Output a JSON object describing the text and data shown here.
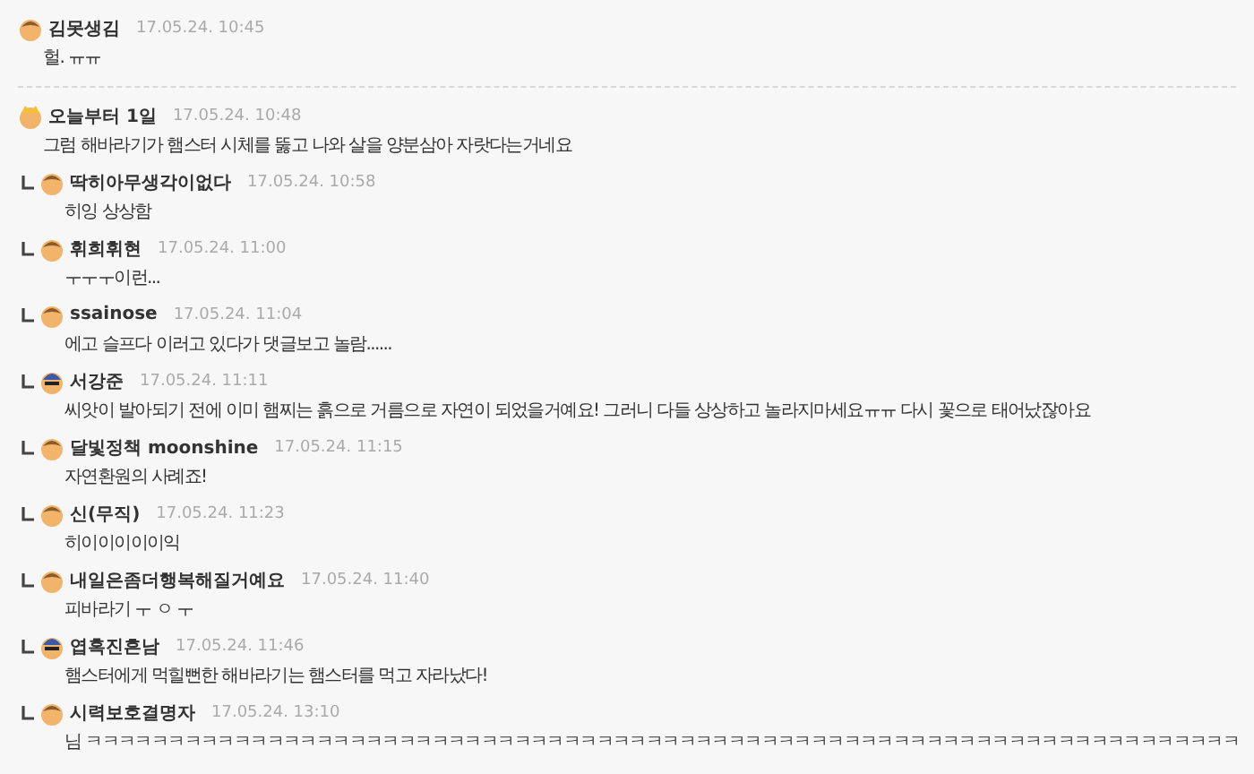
{
  "comments": [
    {
      "author": "김못생김",
      "time": "17.05.24. 10:45",
      "kind": "plain",
      "text": "헐. ㅠㅠ"
    },
    {
      "author": "오늘부터 1일",
      "time": "17.05.24. 10:48",
      "kind": "crown",
      "text": "그럼 해바라기가 햄스터 시체를 뚫고 나와 살을 양분삼아 자랏다는거네요",
      "children": [
        {
          "author": "딱히아무생각이없다",
          "time": "17.05.24. 10:58",
          "kind": "plain",
          "text": "히잉 상상함"
        },
        {
          "author": "휘희휘현",
          "time": "17.05.24. 11:00",
          "kind": "plain",
          "text": "ㅜㅜㅜ이런..."
        },
        {
          "author": "ssainose",
          "time": "17.05.24. 11:04",
          "kind": "plain",
          "text": "에고 슬프다 이러고 있다가 댓글보고 놀람......"
        },
        {
          "author": "서강준",
          "time": "17.05.24. 11:11",
          "kind": "cap",
          "text": "씨앗이 발아되기 전에 이미 햄찌는 흙으로 거름으로 자연이 되었을거예요! 그러니 다들 상상하고 놀라지마세요ㅠㅠ 다시 꽃으로 태어났잖아요"
        },
        {
          "author": "달빛정책 moonshine",
          "time": "17.05.24. 11:15",
          "kind": "plain",
          "text": "자연환원의 사례죠!"
        },
        {
          "author": "신(무직)",
          "time": "17.05.24. 11:23",
          "kind": "plain",
          "text": "히이이이이이익"
        },
        {
          "author": "내일은좀더행복해질거예요",
          "time": "17.05.24. 11:40",
          "kind": "plain",
          "text": "피바라기 ㅜ ㅇ ㅜ"
        },
        {
          "author": "엽혹진흔남",
          "time": "17.05.24. 11:46",
          "kind": "cap",
          "text": "햄스터에게 먹힐뻔한 해바라기는 햄스터를 먹고 자라났다!"
        },
        {
          "author": "시력보호결명자",
          "time": "17.05.24. 13:10",
          "kind": "plain",
          "text": "님 ㅋㅋㅋㅋㅋㅋㅋㅋㅋㅋㅋㅋㅋㅋㅋㅋㅋㅋㅋㅋㅋㅋㅋㅋㅋㅋㅋㅋㅋㅋㅋㅋㅋㅋㅋㅋㅋㅋㅋㅋㅋㅋㅋㅋㅋㅋㅋㅋㅋㅋㅋㅋㅋㅋㅋㅋㅋㅋㅋㅋㅋㅋㅋㅋㅋㅋㅋㅋㅋㅋ"
        }
      ]
    }
  ]
}
